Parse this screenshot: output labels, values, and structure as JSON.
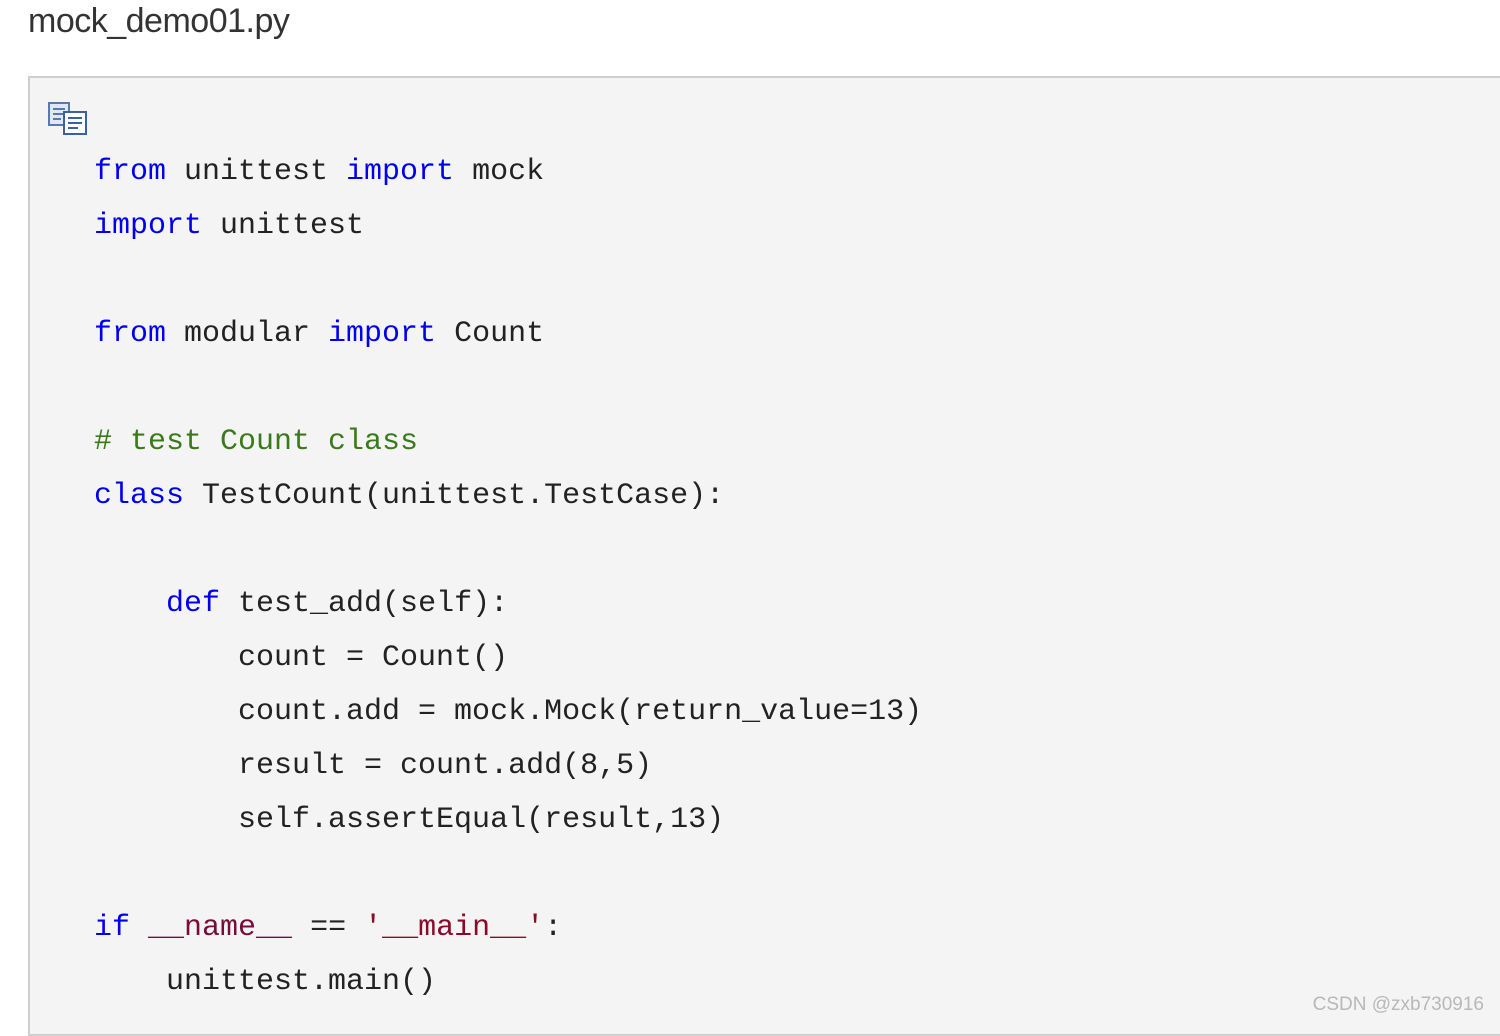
{
  "file_title": "mock_demo01.py",
  "code": {
    "l1": {
      "t1": "from",
      "t2": " unittest ",
      "t3": "import",
      "t4": " mock"
    },
    "l2": {
      "t1": "import",
      "t2": " unittest"
    },
    "l3": {
      "t1": "from",
      "t2": " modular ",
      "t3": "import",
      "t4": " Count"
    },
    "l4": {
      "t1": "# test Count class"
    },
    "l5": {
      "t1": "class",
      "t2": " TestCount(unittest.TestCase):"
    },
    "l6": {
      "t1": "    ",
      "t2": "def",
      "t3": " test_add(self):"
    },
    "l7": {
      "t1": "        count = Count()"
    },
    "l8": {
      "t1": "        count.add = mock.Mock(return_value=13)"
    },
    "l9": {
      "t1": "        result = count.add(8,5)"
    },
    "l10": {
      "t1": "        self.assertEqual(result,13)"
    },
    "l11": {
      "t1": "if",
      "t2": " ",
      "t3": "__name__",
      "t4": " == ",
      "t5": "'__main__'",
      "t6": ":"
    },
    "l12": {
      "t1": "    unittest.main()"
    }
  },
  "watermark": "CSDN @zxb730916",
  "icons": {
    "copy": "copy-icon"
  }
}
